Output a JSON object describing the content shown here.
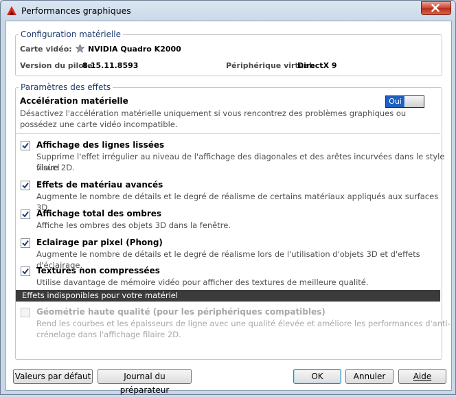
{
  "window": {
    "title": "Performances graphiques"
  },
  "hardware": {
    "group_title": "Configuration matérielle",
    "video_card_label": "Carte vidéo:",
    "video_card_value": "NVIDIA Quadro K2000",
    "driver_label": "Version du pilote:",
    "driver_value": "8.15.11.8593",
    "virtual_device_label": "Périphérique virtuel:",
    "virtual_device_value": "DirectX 9"
  },
  "effects": {
    "group_title": "Paramètres des effets",
    "hw_accel": {
      "title": "Accélération matérielle",
      "desc_line1": "Désactivez l'accélération matérielle uniquement si vous rencontrez des problèmes graphiques ou",
      "desc_line2": "possédez une carte vidéo incompatible.",
      "toggle_label": "Oui",
      "toggle_on": true
    },
    "items": [
      {
        "title": "Affichage des lignes lissées",
        "desc_line1": "Supprime l'effet irrégulier au niveau de l'affichage des diagonales et des arêtes incurvées dans le style visuel",
        "desc_line2": "filaire 2D.",
        "checked": true
      },
      {
        "title": "Effets de matériau avancés",
        "desc_line1": "Augmente le nombre de détails et le degré de réalisme de certains matériaux appliqués aux surfaces 3D.",
        "checked": true
      },
      {
        "title": "Affichage total des ombres",
        "desc_line1": "Affiche les ombres des objets 3D dans la fenêtre.",
        "checked": true
      },
      {
        "title": "Eclairage par pixel (Phong)",
        "desc_line1": "Augmente le nombre de détails et le degré de réalisme lors de l'utilisation d'objets 3D et d'effets d'éclairage.",
        "checked": true
      },
      {
        "title": "Textures non compressées",
        "desc_line1": "Utilise davantage de mémoire vidéo pour afficher des textures de meilleure qualité.",
        "checked": true
      }
    ],
    "unavailable_header": "Effets indisponibles pour votre matériel",
    "unavailable": {
      "title": "Géométrie haute qualité (pour les périphériques compatibles)",
      "desc_line1": "Rend les courbes et les épaisseurs de ligne avec une qualité élevée et améliore les performances d'anti-",
      "desc_line2": "crénelage dans l'affichage filaire 2D.",
      "checked": false
    }
  },
  "buttons": {
    "defaults": "Valeurs par défaut",
    "journal": "Journal du préparateur",
    "ok": "OK",
    "cancel": "Annuler",
    "help": "Aide"
  },
  "colors": {
    "toggle_on": "#1f5fbf",
    "group_title": "#1e3c6e",
    "unavailable_bar": "#3b3b3b",
    "close_button": "#c7412c"
  },
  "icons": {
    "app": "autocad-a-icon",
    "close": "close-icon",
    "video": "star-icon",
    "check": "checkmark-icon"
  }
}
